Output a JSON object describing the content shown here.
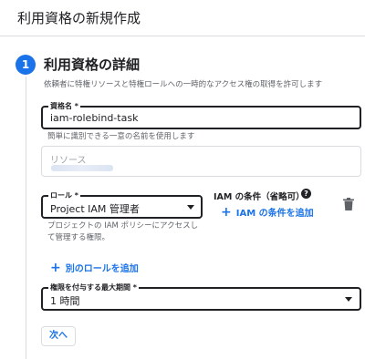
{
  "header": {
    "title": "利用資格の新規作成"
  },
  "step": {
    "number": "1",
    "title": "利用資格の詳細",
    "description": "依頼者に特権リソースと特権ロールへの一時的なアクセス権の取得を許可します"
  },
  "entitlement_name": {
    "label": "資格名 *",
    "value": "iam-rolebind-task",
    "hint": "簡単に識別できる一意の名前を使用します"
  },
  "resource": {
    "label": "リソース"
  },
  "role": {
    "label": "ロール *",
    "value": "Project IAM 管理者",
    "hint": "プロジェクトの IAM ポリシーにアクセスして管理する権限。"
  },
  "iam_condition": {
    "label": "IAM の条件（省略可）",
    "help_icon": "?",
    "add_label": "IAM の条件を追加"
  },
  "add_role": {
    "label": "別のロールを追加"
  },
  "max_duration": {
    "label": "権限を付与する最大期間 *",
    "value": "1 時間"
  },
  "next_button": {
    "label": "次へ"
  },
  "icons": {
    "plus": "+",
    "dropdown": "arrow-drop-down-icon",
    "delete": "trash-icon"
  },
  "colors": {
    "accent": "#1a73e8",
    "text": "#202124",
    "secondary_text": "#5f6368",
    "border": "#dadce0"
  }
}
